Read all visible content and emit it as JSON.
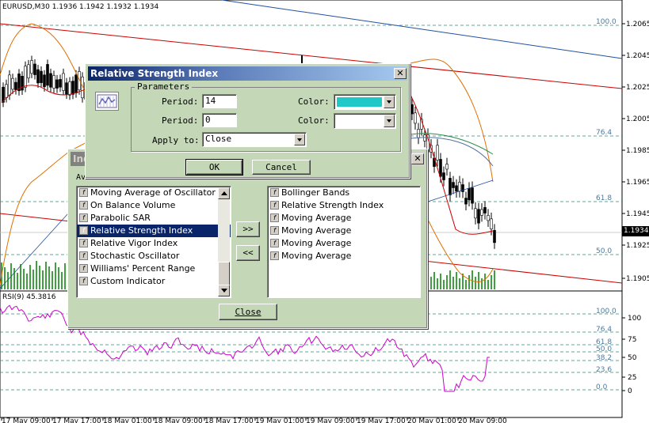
{
  "chart": {
    "header": "EURUSD,M30  1.1936 1.1942 1.1932 1.1934",
    "price_axis": [
      "1.2065",
      "1.2045",
      "1.2025",
      "1.2005",
      "1.1985",
      "1.1965",
      "1.1945",
      "1.1925",
      "1.1905"
    ],
    "current_price": "1.1934",
    "fib_levels": [
      "100.0",
      "76.4",
      "61.8",
      "50.0"
    ],
    "rsi_header": "RSI(9)  45.3816",
    "rsi_axis": [
      "100",
      "75",
      "50",
      "25",
      "0"
    ],
    "rsi_fib_levels": [
      "100.0",
      "76.4",
      "61.8",
      "50.0",
      "38.2",
      "23.6",
      "0.0"
    ],
    "time_axis": [
      "17 May 09:00",
      "17 May 17:00",
      "18 May 01:00",
      "18 May 09:00",
      "18 May 17:00",
      "19 May 01:00",
      "19 May 09:00",
      "19 May 17:00",
      "20 May 01:00",
      "20 May 09:00"
    ],
    "colors": {
      "rsi": "#cc00cc",
      "bollinger": "#e07000",
      "ma_red": "#cc0000",
      "fib": "#2e8b7a",
      "trend_red": "#cc0000",
      "trend_blue": "#2050a0",
      "volume": "#008000"
    }
  },
  "indicators_dialog": {
    "title": "Ind",
    "available_label": "Av",
    "available": [
      "Moving Average of Oscillator",
      "On Balance Volume",
      "Parabolic SAR",
      "Relative Strength Index",
      "Relative Vigor Index",
      "Stochastic Oscillator",
      "Williams' Percent Range",
      "Custom Indicator"
    ],
    "selected_index": 3,
    "add_button": ">>",
    "remove_button": "<<",
    "applied": [
      "Bollinger Bands",
      "Relative Strength Index",
      "Moving Average",
      "Moving Average",
      "Moving Average",
      "Moving Average"
    ],
    "close_button": "Close",
    "close_icon": "close-icon",
    "item_icon": "f"
  },
  "rsi_dialog": {
    "title": "Relative Strength Index",
    "group_title": "Parameters",
    "period_label": "Period:",
    "period_value": "14",
    "period2_label": "Period:",
    "period2_value": "0",
    "color_label": "Color:",
    "color_value": "#20c8c8",
    "color2_label": "Color:",
    "color2_value": "#ffffff",
    "apply_label": "Apply to:",
    "apply_value": "Close",
    "ok_button": "OK",
    "cancel_button": "Cancel",
    "close_icon": "close-icon",
    "app_icon": "indicator-chart-icon"
  }
}
